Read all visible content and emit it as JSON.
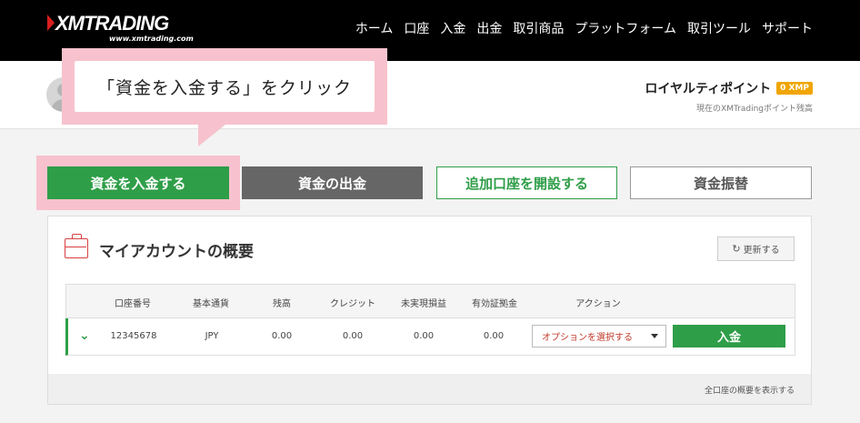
{
  "header": {
    "logo_text": "XMTRADING",
    "logo_url_text": "www.xmtrading.com",
    "nav": [
      "ホーム",
      "口座",
      "入金",
      "出金",
      "取引商品",
      "プラットフォーム",
      "取引ツール",
      "サポート"
    ]
  },
  "profile": {
    "royalty_title": "ロイヤルティポイント",
    "xmp_badge": "0 XMP",
    "royalty_sub": "現在のXMTradingポイント残高"
  },
  "callout": {
    "text": "「資金を入金する」をクリック"
  },
  "actions": {
    "deposit": "資金を入金する",
    "withdraw": "資金の出金",
    "open_account": "追加口座を開設する",
    "transfer": "資金振替"
  },
  "panel": {
    "title": "マイアカウントの概要",
    "refresh": "更新する",
    "columns": [
      "口座番号",
      "基本通貨",
      "残高",
      "クレジット",
      "未実現損益",
      "有効証拠金",
      "アクション"
    ],
    "rows": [
      {
        "account": "12345678",
        "currency": "JPY",
        "balance": "0.00",
        "credit": "0.00",
        "unrealized": "0.00",
        "equity": "0.00",
        "select_label": "オプションを選択する",
        "deposit_label": "入金"
      }
    ],
    "footer_link": "全口座の概要を表示する"
  },
  "colors": {
    "brand_black": "#000000",
    "accent_green": "#2f9e48",
    "callout_pink": "#f7c2cd",
    "logo_red": "#d81e1e"
  }
}
